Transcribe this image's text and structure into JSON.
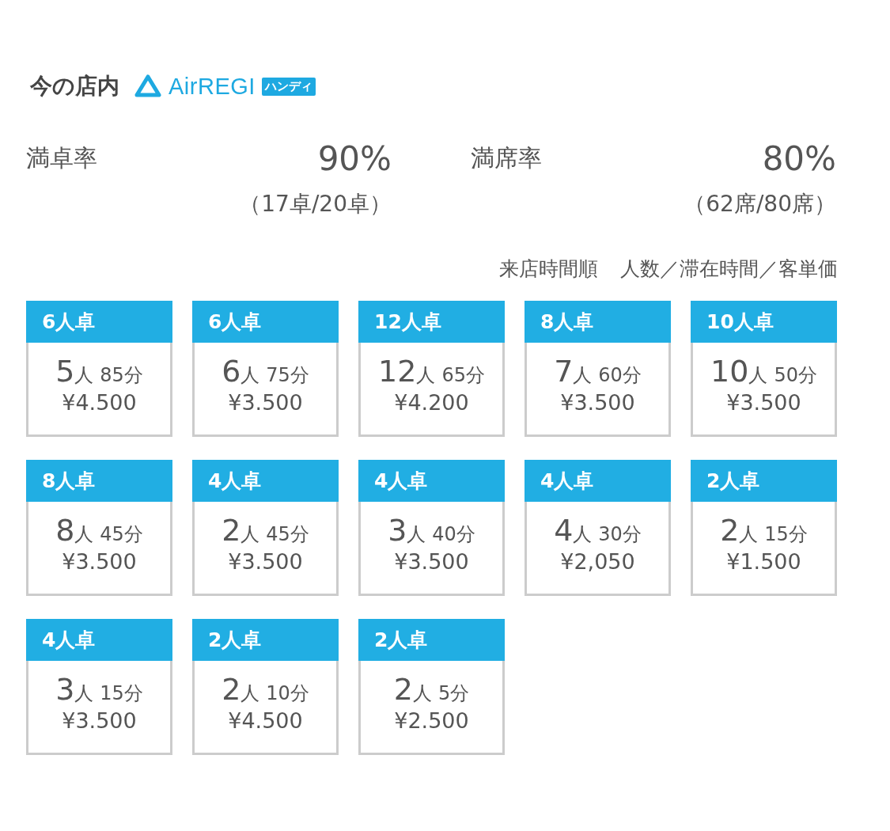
{
  "header": {
    "title": "今の店内",
    "logo": {
      "wordmark": "AirREGI",
      "badge": "ハンディ"
    }
  },
  "stats": [
    {
      "label": "満卓率",
      "value": "90%",
      "detail": "（17卓/20卓）"
    },
    {
      "label": "満席率",
      "value": "80%",
      "detail": "（62席/80席）"
    }
  ],
  "sort": {
    "order": "来店時間順",
    "fields": "人数／滞在時間／客単価"
  },
  "tables": [
    {
      "name": "6人卓",
      "guests": "5",
      "unit": "人",
      "stay": "85分",
      "spend": "¥4.500"
    },
    {
      "name": "6人卓",
      "guests": "6",
      "unit": "人",
      "stay": "75分",
      "spend": "¥3.500"
    },
    {
      "name": "12人卓",
      "guests": "12",
      "unit": "人",
      "stay": "65分",
      "spend": "¥4.200"
    },
    {
      "name": "8人卓",
      "guests": "7",
      "unit": "人",
      "stay": "60分",
      "spend": "¥3.500"
    },
    {
      "name": "10人卓",
      "guests": "10",
      "unit": "人",
      "stay": "50分",
      "spend": "¥3.500"
    },
    {
      "name": "8人卓",
      "guests": "8",
      "unit": "人",
      "stay": "45分",
      "spend": "¥3.500"
    },
    {
      "name": "4人卓",
      "guests": "2",
      "unit": "人",
      "stay": "45分",
      "spend": "¥3.500"
    },
    {
      "name": "4人卓",
      "guests": "3",
      "unit": "人",
      "stay": "40分",
      "spend": "¥3.500"
    },
    {
      "name": "4人卓",
      "guests": "4",
      "unit": "人",
      "stay": "30分",
      "spend": "¥2,050"
    },
    {
      "name": "2人卓",
      "guests": "2",
      "unit": "人",
      "stay": "15分",
      "spend": "¥1.500"
    },
    {
      "name": "4人卓",
      "guests": "3",
      "unit": "人",
      "stay": "15分",
      "spend": "¥3.500"
    },
    {
      "name": "2人卓",
      "guests": "2",
      "unit": "人",
      "stay": "10分",
      "spend": "¥4.500"
    },
    {
      "name": "2人卓",
      "guests": "2",
      "unit": "人",
      "stay": "5分",
      "spend": "¥2.500"
    }
  ]
}
